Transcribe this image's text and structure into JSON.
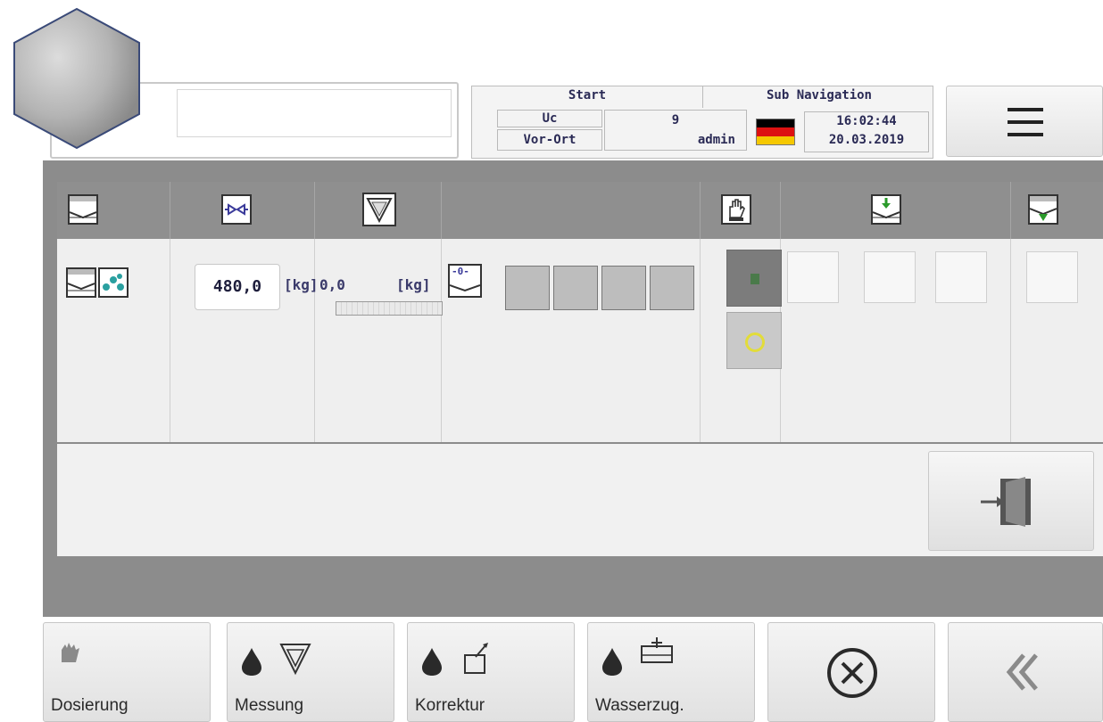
{
  "header": {
    "start_label": "Start",
    "subnav_label": "Sub Navigation",
    "cell_uc": "Uc",
    "cell_nine": "9",
    "cell_vor_ort": "Vor-Ort",
    "cell_admin": "admin",
    "time": "16:02:44",
    "date": "20.03.2019",
    "flag_colors": [
      "#000000",
      "#dd1111",
      "#f5c800"
    ]
  },
  "table": {
    "value_input": "480,0",
    "value_unit": "[kg]",
    "reading_value": "0,0",
    "reading_unit": "[kg]",
    "zero_label": "-0-"
  },
  "footer": {
    "buttons": [
      "Dosierung",
      "Messung",
      "Korrektur",
      "Wasserzug."
    ]
  },
  "colors": {
    "panel": "#8c8c8c",
    "header_row": "#8f8f8f",
    "text": "#2a2a55",
    "stop_ring": "#e2dc3a"
  }
}
